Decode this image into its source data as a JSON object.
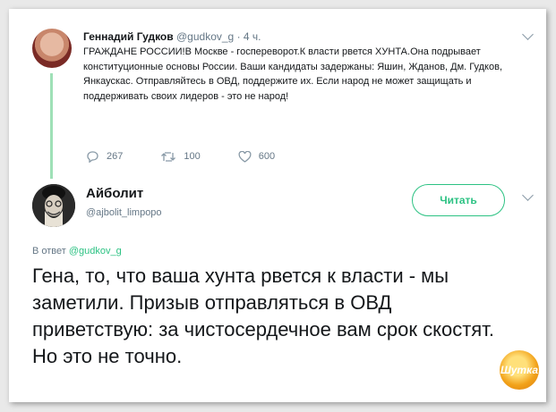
{
  "parent_tweet": {
    "author_name": "Геннадий Гудков",
    "handle": "@gudkov_g",
    "separator": "·",
    "time": "4 ч.",
    "text": "ГРАЖДАНЕ РОССИИ!В Москве - госпереворот.К власти рвется ХУНТА.Она подрывает конституционные основы России. Ваши кандидаты задержаны: Яшин, Жданов, Дм. Гудков, Янкаускас. Отправляйтесь в ОВД, поддержите их. Если народ не может защищать и поддерживать своих лидеров - это не народ!",
    "replies": "267",
    "retweets": "100",
    "likes": "600"
  },
  "reply_tweet": {
    "author_name": "Айболит",
    "handle": "@ajbolit_limpopo",
    "follow_label": "Читать",
    "reply_to_prefix": "В ответ",
    "reply_to_handle": "@gudkov_g",
    "text": "Гена, то, что ваша хунта рвется к власти - мы заметили. Призыв отправляться в ОВД приветствую: за чистосердечное вам срок скостят. Но это не точно."
  },
  "watermark": {
    "text": "Шутка"
  },
  "colors": {
    "accent": "#2cc283",
    "thread_line": "#9fe0b7",
    "secondary_text": "#657786"
  },
  "icons": [
    "reply-icon",
    "retweet-icon",
    "like-icon",
    "chevron-down-icon"
  ]
}
